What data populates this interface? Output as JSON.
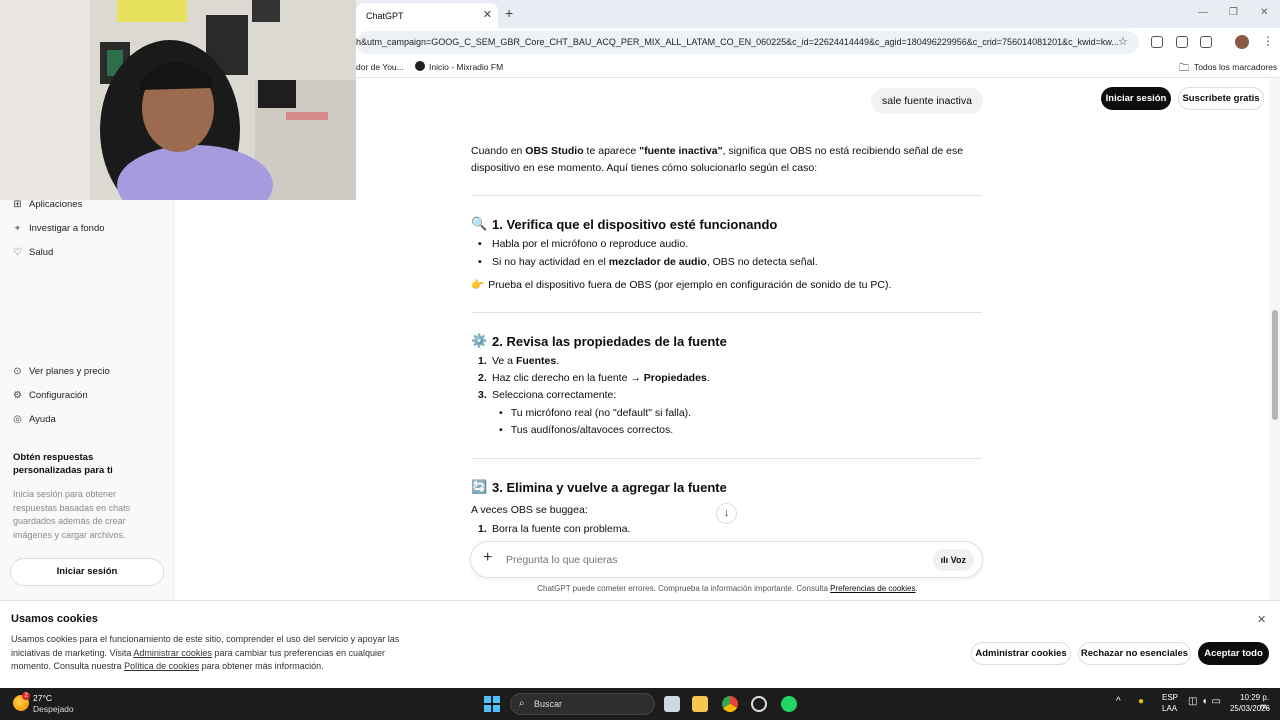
{
  "browser": {
    "tab_title": "ChatGPT",
    "tab_close": "✕",
    "new_tab": "+",
    "url": "h&utm_campaign=GOOG_C_SEM_GBR_Core_CHT_BAU_ACQ_PER_MIX_ALL_LATAM_CO_EN_060225&c_id=22624414449&c_agid=180496229956&c_crid=756014081201&c_kwid=kw...",
    "bookmarks": [
      "dor de You...",
      "Inicio - Mixradio FM"
    ],
    "all_bookmarks": "Todos los marcadores"
  },
  "sidebar": {
    "items_top": [
      {
        "icon": "grid-icon",
        "label": "Aplicaciones"
      },
      {
        "icon": "telescope-icon",
        "label": "Investigar a fondo"
      },
      {
        "icon": "heart-icon",
        "label": "Salud"
      }
    ],
    "items_bottom": [
      {
        "icon": "plans-icon",
        "label": "Ver planes y precio"
      },
      {
        "icon": "gear-icon",
        "label": "Configuración"
      },
      {
        "icon": "help-icon",
        "label": "Ayuda"
      }
    ],
    "promo_title": "Obtén respuestas personalizadas para ti",
    "promo_text": "Inicia sesión para obtener respuestas basadas en chats guardados además de crear imágenes y cargar archivos.",
    "login_button": "Iniciar sesión"
  },
  "header": {
    "login_button": "Iniciar sesión",
    "subscribe_button": "Suscríbete gratis"
  },
  "chat": {
    "user_message": "sale fuente inactiva",
    "intro_a": "Cuando en ",
    "intro_b": "OBS Studio",
    "intro_c": " te aparece ",
    "intro_d": "\"fuente inactiva\"",
    "intro_e": ", significa que OBS no está recibiendo señal de ese",
    "intro_line2": "dispositivo en ese momento. Aquí tienes cómo solucionarlo según el caso:",
    "s1_emoji": "🔍",
    "s1_title": "1. Verifica que el dispositivo esté funcionando",
    "s1_b1": "Habla por el micrófono o reproduce audio.",
    "s1_b2a": "Si no hay actividad en el ",
    "s1_b2b": "mezclador de audio",
    "s1_b2c": ", OBS no detecta señal.",
    "s1_tip_emoji": "👉",
    "s1_tip": "Prueba el dispositivo fuera de OBS (por ejemplo en configuración de sonido de tu PC).",
    "s2_emoji": "⚙️",
    "s2_title": "2. Revisa las propiedades de la fuente",
    "s2_n1_mk": "1.",
    "s2_n1a": "Ve a ",
    "s2_n1b": "Fuentes",
    "s2_n1c": ".",
    "s2_n2_mk": "2.",
    "s2_n2a": "Haz clic derecho en la fuente → ",
    "s2_n2b": "Propiedades",
    "s2_n2c": ".",
    "s2_n3_mk": "3.",
    "s2_n3": "Selecciona correctamente:",
    "s2_sub1": "Tu micrófono real (no \"default\" si falla).",
    "s2_sub2": "Tus audífonos/altavoces correctos.",
    "s3_emoji": "🔄",
    "s3_title": "3. Elimina y vuelve a agregar la fuente",
    "s3_intro": "A veces OBS se buggea:",
    "s3_n1_mk": "1.",
    "s3_n1": "Borra la fuente con problema."
  },
  "composer": {
    "placeholder": "Pregunta lo que quieras",
    "voice_label": "Voz",
    "disclaimer_a": "ChatGPT puede cometer errores. Comprueba la información importante. Consulta ",
    "disclaimer_link": "Preferencias de cookies",
    "disclaimer_b": "."
  },
  "cookies": {
    "title": "Usamos cookies",
    "text_a": "Usamos cookies para el funcionamiento de este sitio, comprender el uso del servicio y apoyar las iniciativas de marketing. Visita ",
    "link1": "Administrar cookies",
    "text_b": " para cambiar tus preferencias en cualquier momento. Consulta nuestra ",
    "link2": "Política de cookies",
    "text_c": " para obtener más información.",
    "manage_button": "Administrar cookies",
    "reject_button": "Rechazar no esenciales",
    "accept_button": "Aceptar todo"
  },
  "taskbar": {
    "weather_badge": "2",
    "temperature": "27°C",
    "weather": "Despejado",
    "search_label": "Buscar",
    "lang_top": "ESP",
    "lang_bottom": "LAA",
    "time": "10:29 p. m.",
    "date": "25/03/2026"
  }
}
